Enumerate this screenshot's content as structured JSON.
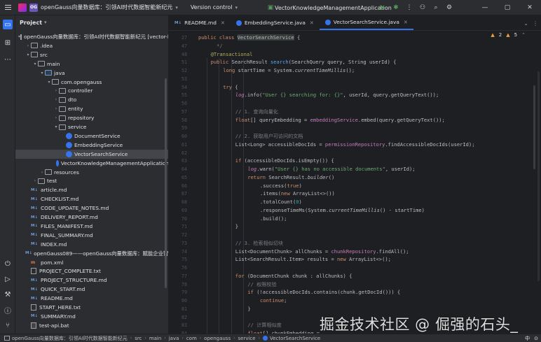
{
  "titlebar": {
    "project_badge": "OG",
    "project_name": "openGauss向量数据库：引领AI时代数据智能新纪元",
    "version_control": "Version control",
    "run_config": "VectorKnowledgeManagementApplication"
  },
  "project_panel": {
    "title": "Project",
    "tree": [
      {
        "label": "openGauss向量数据库：引领AI时代数据智能新纪元 [vector-kno",
        "depth": 0,
        "arrow": "▾",
        "kind": "root"
      },
      {
        "label": ".idea",
        "depth": 1,
        "arrow": "›",
        "kind": "folder"
      },
      {
        "label": "src",
        "depth": 1,
        "arrow": "▾",
        "kind": "folder"
      },
      {
        "label": "main",
        "depth": 2,
        "arrow": "▾",
        "kind": "folder"
      },
      {
        "label": "java",
        "depth": 3,
        "arrow": "▾",
        "kind": "folder-blue"
      },
      {
        "label": "com.opengauss",
        "depth": 4,
        "arrow": "▾",
        "kind": "pkg"
      },
      {
        "label": "controller",
        "depth": 5,
        "arrow": "›",
        "kind": "pkg"
      },
      {
        "label": "dto",
        "depth": 5,
        "arrow": "›",
        "kind": "pkg"
      },
      {
        "label": "entity",
        "depth": 5,
        "arrow": "›",
        "kind": "pkg"
      },
      {
        "label": "repository",
        "depth": 5,
        "arrow": "›",
        "kind": "pkg"
      },
      {
        "label": "service",
        "depth": 5,
        "arrow": "▾",
        "kind": "pkg"
      },
      {
        "label": "DocumentService",
        "depth": 6,
        "arrow": "",
        "kind": "class"
      },
      {
        "label": "EmbeddingService",
        "depth": 6,
        "arrow": "",
        "kind": "class"
      },
      {
        "label": "VectorSearchService",
        "depth": 6,
        "arrow": "",
        "kind": "class",
        "selected": true
      },
      {
        "label": "VectorKnowledgeManagementApplication",
        "depth": 5,
        "arrow": "",
        "kind": "class"
      },
      {
        "label": "resources",
        "depth": 3,
        "arrow": "›",
        "kind": "folder"
      },
      {
        "label": "test",
        "depth": 2,
        "arrow": "›",
        "kind": "folder"
      },
      {
        "label": "article.md",
        "depth": 1,
        "arrow": "",
        "kind": "md"
      },
      {
        "label": "CHECKLIST.md",
        "depth": 1,
        "arrow": "",
        "kind": "md"
      },
      {
        "label": "CODE_UPDATE_NOTES.md",
        "depth": 1,
        "arrow": "",
        "kind": "md"
      },
      {
        "label": "DELIVERY_REPORT.md",
        "depth": 1,
        "arrow": "",
        "kind": "md"
      },
      {
        "label": "FILES_MANIFEST.md",
        "depth": 1,
        "arrow": "",
        "kind": "md"
      },
      {
        "label": "FINAL_SUMMARY.md",
        "depth": 1,
        "arrow": "",
        "kind": "md"
      },
      {
        "label": "INDEX.md",
        "depth": 1,
        "arrow": "",
        "kind": "md"
      },
      {
        "label": "openGauss089——openGauss向量数据库：赋能企业智能知识",
        "depth": 1,
        "arrow": "",
        "kind": "md"
      },
      {
        "label": "pom.xml",
        "depth": 1,
        "arrow": "",
        "kind": "xml"
      },
      {
        "label": "PROJECT_COMPLETE.txt",
        "depth": 1,
        "arrow": "",
        "kind": "txt"
      },
      {
        "label": "PROJECT_STRUCTURE.md",
        "depth": 1,
        "arrow": "",
        "kind": "md"
      },
      {
        "label": "QUICK_START.md",
        "depth": 1,
        "arrow": "",
        "kind": "md"
      },
      {
        "label": "README.md",
        "depth": 1,
        "arrow": "",
        "kind": "md"
      },
      {
        "label": "START_HERE.txt",
        "depth": 1,
        "arrow": "",
        "kind": "txt"
      },
      {
        "label": "SUMMARY.md",
        "depth": 1,
        "arrow": "",
        "kind": "md"
      },
      {
        "label": "test-api.bat",
        "depth": 1,
        "arrow": "",
        "kind": "bat"
      }
    ]
  },
  "editor": {
    "tabs": [
      {
        "label": "README.md",
        "kind": "md",
        "active": false
      },
      {
        "label": "EmbeddingService.java",
        "kind": "class",
        "active": false
      },
      {
        "label": "VectorSearchService.java",
        "kind": "class",
        "active": true
      }
    ],
    "inspections": {
      "warnings": "2",
      "infos": "5"
    },
    "lines": [
      {
        "n": "27",
        "ind": 0,
        "html": "<span class=\"k\">public class</span> <span class=\"hlname\">VectorSearchService</span> {"
      },
      {
        "n": "47",
        "ind": 1,
        "html": "  <span class=\"cm\">*/</span>"
      },
      {
        "n": "48",
        "ind": 1,
        "html": "<span class=\"an\">@Transactional</span>"
      },
      {
        "n": "51",
        "ind": 1,
        "html": "<span class=\"k\">public</span> SearchResult <span class=\"fn\">search</span>(SearchQuery query, String userId) {"
      },
      {
        "n": "52",
        "ind": 2,
        "html": "<span class=\"k\">long</span> startTime = System.<span class=\"it\">currentTimeMillis</span>();"
      },
      {
        "n": "53",
        "ind": 0,
        "html": ""
      },
      {
        "n": "54",
        "ind": 2,
        "html": "<span class=\"k\">try</span> {"
      },
      {
        "n": "55",
        "ind": 3,
        "html": "<span class=\"fld it\">log</span>.info(<span class=\"s\">\"User {} searching for: {}\"</span>, userId, query.getQueryText());"
      },
      {
        "n": "56",
        "ind": 0,
        "html": ""
      },
      {
        "n": "57",
        "ind": 3,
        "html": "<span class=\"cm\">// 1. 查询向量化</span>"
      },
      {
        "n": "58",
        "ind": 3,
        "html": "<span class=\"k\">float</span>[] queryEmbedding = <span class=\"fld\">embeddingService</span>.embed(query.getQueryText());"
      },
      {
        "n": "59",
        "ind": 0,
        "html": ""
      },
      {
        "n": "60",
        "ind": 3,
        "html": "<span class=\"cm\">// 2. 获取用户可访问的文档</span>"
      },
      {
        "n": "61",
        "ind": 3,
        "html": "List&lt;Long&gt; accessibleDocIds = <span class=\"fld\">permissionRepository</span>.findAccessibleDocIds(userId);"
      },
      {
        "n": "62",
        "ind": 0,
        "html": ""
      },
      {
        "n": "63",
        "ind": 3,
        "html": "<span class=\"k\">if</span> (accessibleDocIds.isEmpty()) {"
      },
      {
        "n": "64",
        "ind": 4,
        "html": "<span class=\"fld it\">log</span>.warn(<span class=\"s\">\"User {} has no accessible documents\"</span>, userId);"
      },
      {
        "n": "65",
        "ind": 4,
        "html": "<span class=\"k\">return</span> SearchResult.<span class=\"it\">builder</span>()"
      },
      {
        "n": "66",
        "ind": 5,
        "html": ".success(<span class=\"k\">true</span>)"
      },
      {
        "n": "67",
        "ind": 5,
        "html": ".items(<span class=\"k\">new</span> ArrayList&lt;&gt;())"
      },
      {
        "n": "68",
        "ind": 5,
        "html": ".totalCount(<span class=\"num\">0</span>)"
      },
      {
        "n": "69",
        "ind": 5,
        "html": ".responseTimeMs(System.<span class=\"it\">currentTimeMillis</span>() - startTime)"
      },
      {
        "n": "70",
        "ind": 5,
        "html": ".build();"
      },
      {
        "n": "71",
        "ind": 3,
        "html": "}"
      },
      {
        "n": "72",
        "ind": 0,
        "html": ""
      },
      {
        "n": "73",
        "ind": 3,
        "html": "<span class=\"cm\">// 3. 检索相似切块</span>"
      },
      {
        "n": "74",
        "ind": 3,
        "html": "List&lt;DocumentChunk&gt; allChunks = <span class=\"fld\">chunkRepository</span>.findAll();"
      },
      {
        "n": "75",
        "ind": 3,
        "html": "List&lt;SearchResult.Item&gt; results = <span class=\"k\">new</span> ArrayList&lt;&gt;();"
      },
      {
        "n": "76",
        "ind": 0,
        "html": ""
      },
      {
        "n": "77",
        "ind": 3,
        "html": "<span class=\"k\">for</span> (DocumentChunk chunk : allChunks) {"
      },
      {
        "n": "78",
        "ind": 4,
        "html": "<span class=\"cm\">// 权限校验</span>"
      },
      {
        "n": "79",
        "ind": 4,
        "html": "<span class=\"k\">if</span> (!accessibleDocIds.contains(chunk.getDocId())) {"
      },
      {
        "n": "80",
        "ind": 5,
        "html": "<span class=\"k\">continue</span>;"
      },
      {
        "n": "81",
        "ind": 4,
        "html": "}"
      },
      {
        "n": "82",
        "ind": 0,
        "html": ""
      },
      {
        "n": "83",
        "ind": 4,
        "html": "<span class=\"cm\">// 计算相似度</span>"
      },
      {
        "n": "84",
        "ind": 4,
        "html": "<span class=\"k\">float</span>[] chunkEmbedding = ..."
      }
    ]
  },
  "breadcrumbs": [
    {
      "label": "openGauss向量数据库：引领AI时代数据智能新纪元",
      "kind": "folder"
    },
    {
      "label": "src",
      "kind": "folder"
    },
    {
      "label": "main",
      "kind": "folder"
    },
    {
      "label": "java",
      "kind": "folder"
    },
    {
      "label": "com",
      "kind": "folder"
    },
    {
      "label": "opengauss",
      "kind": "folder"
    },
    {
      "label": "service",
      "kind": "folder"
    },
    {
      "label": "VectorSearchService",
      "kind": "class"
    }
  ],
  "statusbar_right": {
    "lang": "中",
    "ime": "⊙"
  },
  "watermark": "掘金技术社区 @ 倔强的石头_"
}
